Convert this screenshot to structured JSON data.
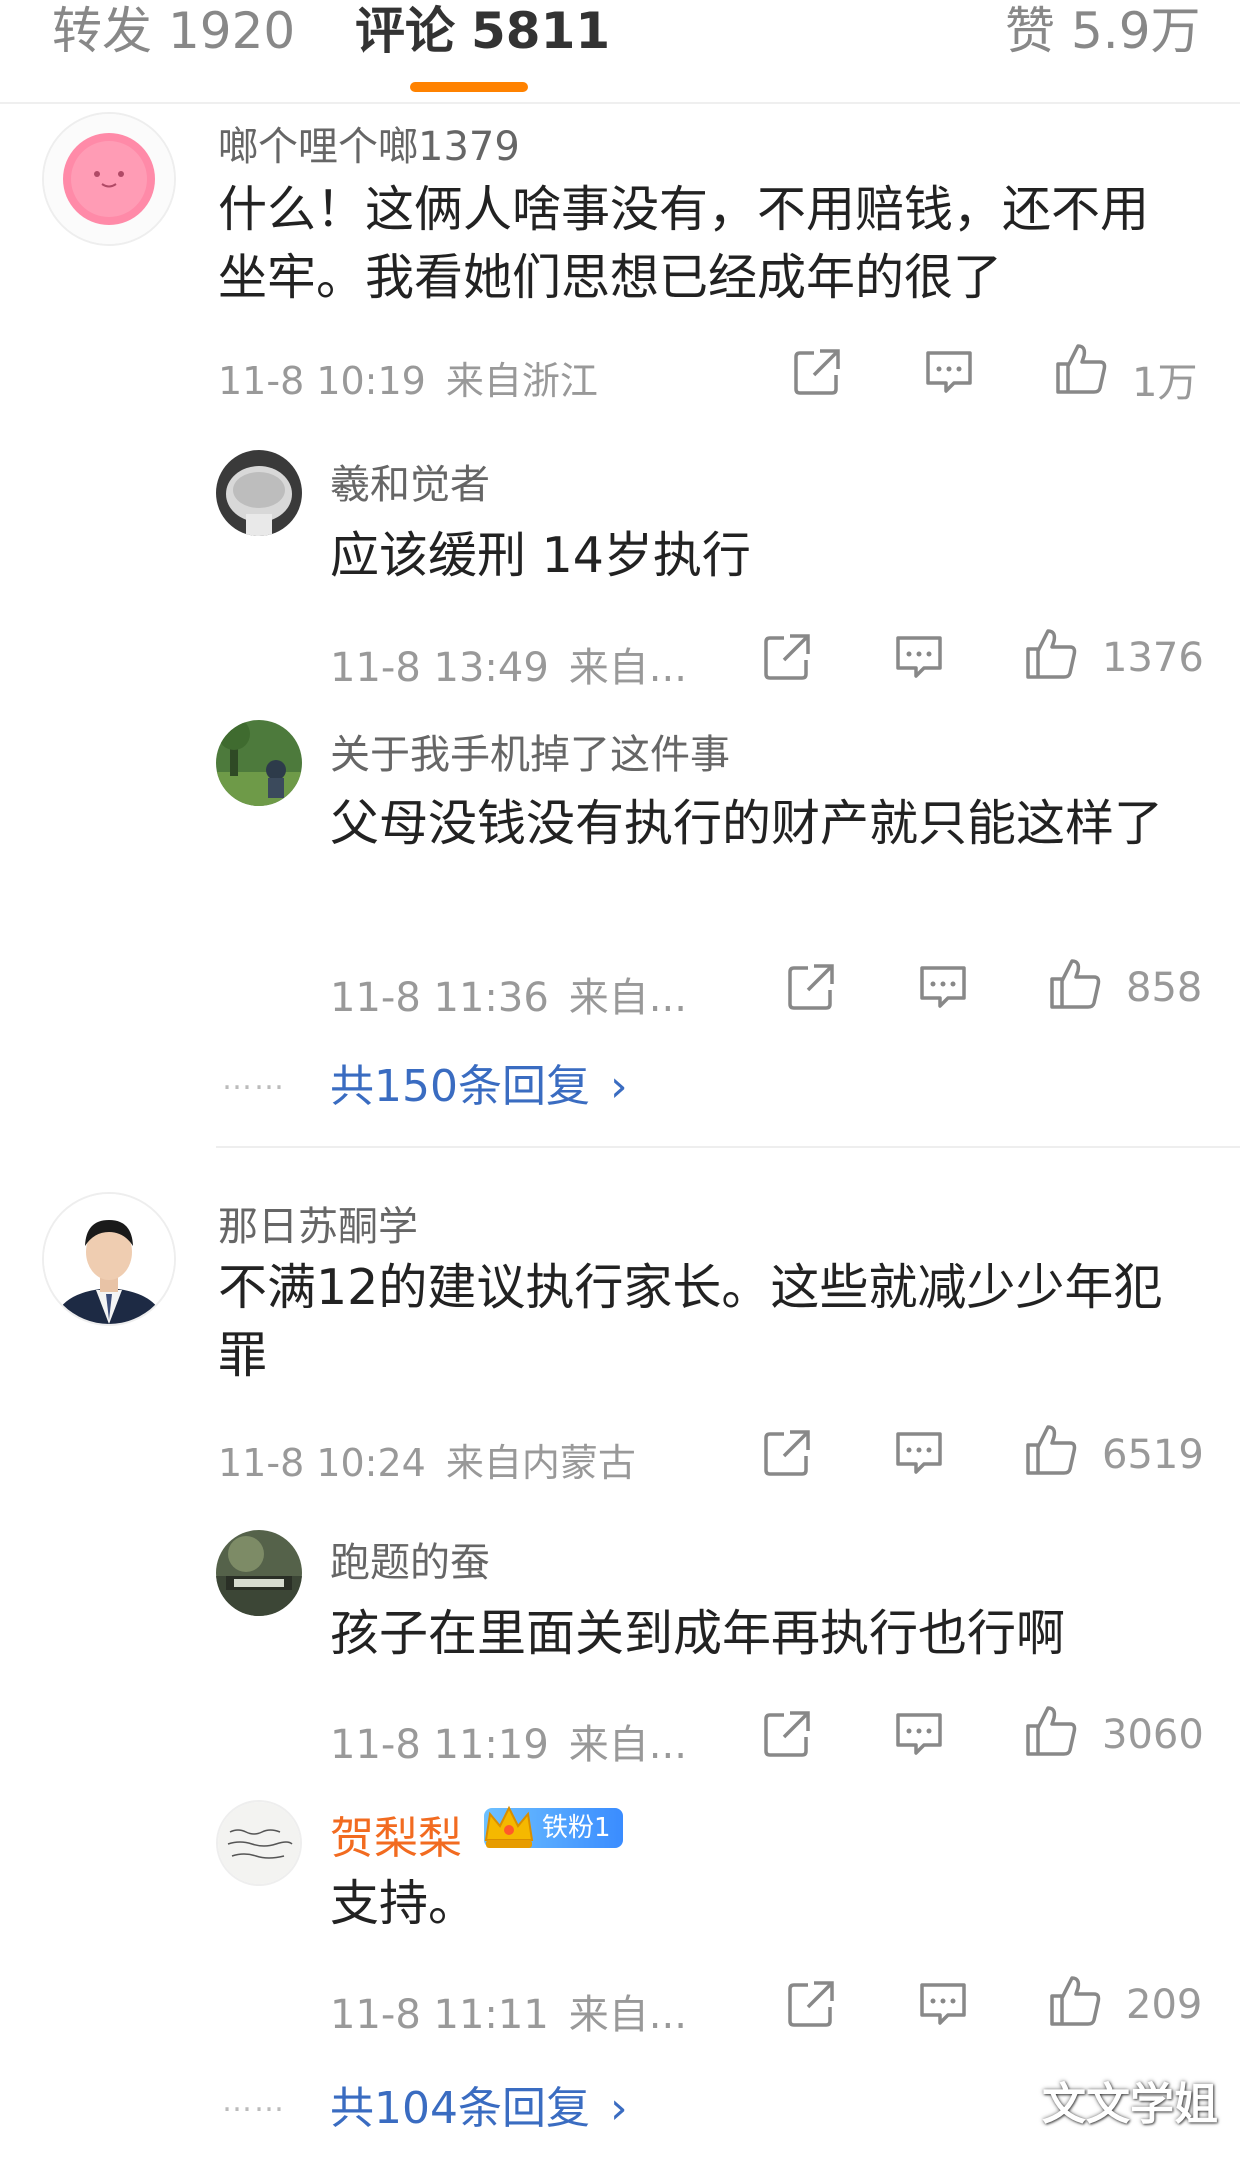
{
  "tabs": {
    "repost": {
      "label": "转发",
      "count": "1920"
    },
    "comments": {
      "label": "评论",
      "count": "5811"
    },
    "likes": {
      "label": "赞",
      "count": "5.9万"
    }
  },
  "comments": [
    {
      "user": "啷个哩个啷1379",
      "text": "什么！这俩人啥事没有，不用赔钱，还不用坐牢。我看她们思想已经成年的很了",
      "time": "11-8 10:19",
      "location": "来自浙江",
      "likes": "1万",
      "replies": [
        {
          "user": "羲和觉者",
          "text": "应该缓刑 14岁执行",
          "time": "11-8 13:49",
          "location": "来自...",
          "likes": "1376"
        },
        {
          "user": "关于我手机掉了这件事",
          "text": "父母没钱没有执行的财产就只能这样了",
          "time": "11-8 11:36",
          "location": "来自...",
          "likes": "858"
        }
      ],
      "more_replies": "共150条回复"
    },
    {
      "user": "那日苏酮学",
      "text": "不满12的建议执行家长。这些就减少少年犯罪",
      "time": "11-8 10:24",
      "location": "来自内蒙古",
      "likes": "6519",
      "replies": [
        {
          "user": "跑题的蚕",
          "text": "孩子在里面关到成年再执行也行啊",
          "time": "11-8 11:19",
          "location": "来自...",
          "likes": "3060"
        },
        {
          "user": "贺梨梨",
          "badge": "铁粉1",
          "text": "支持。",
          "time": "11-8 11:11",
          "location": "来自...",
          "likes": "209"
        }
      ],
      "more_replies": "共104条回复"
    }
  ],
  "more_dots": "……",
  "arrow": "›",
  "watermark": "文文学姐",
  "colors": {
    "accent": "#ff8200",
    "link": "#3a6cc1",
    "vip_name": "#f26b20",
    "meta": "#999999"
  },
  "icons": [
    "share-icon",
    "comment-icon",
    "like-icon",
    "chevron-right-icon",
    "crown-icon"
  ]
}
